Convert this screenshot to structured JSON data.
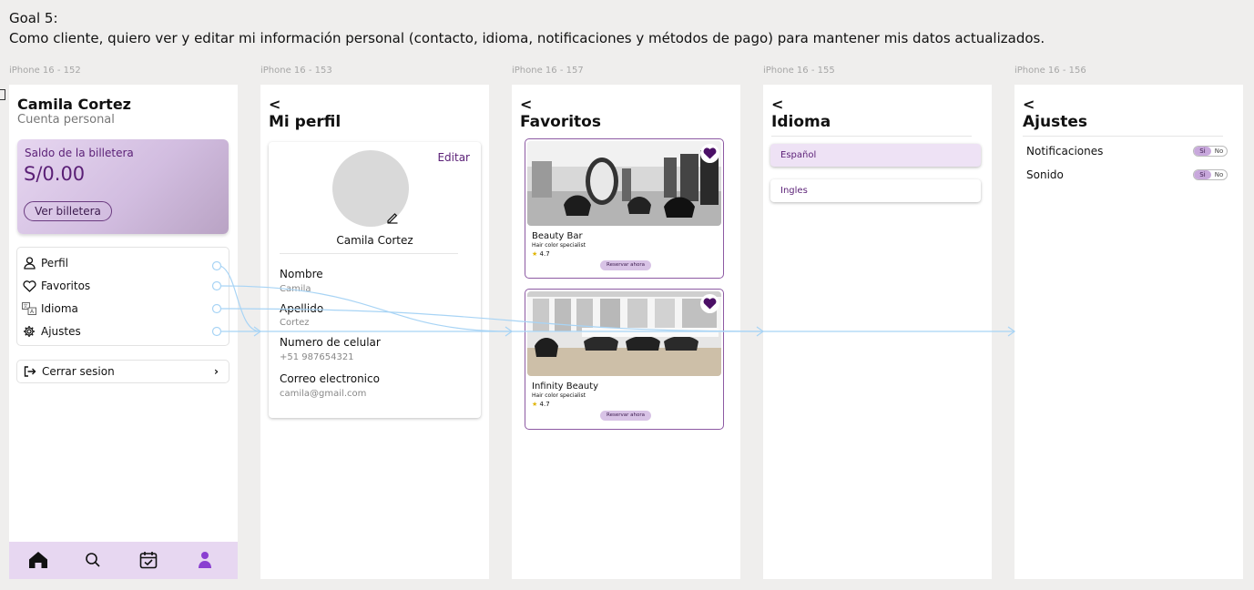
{
  "goal": {
    "title": "Goal 5:",
    "text": "Como cliente, quiero ver y editar mi información personal (contacto, idioma, notificaciones y métodos de pago) para mantener mis datos actualizados."
  },
  "frames": [
    {
      "label": "iPhone 16 - 152"
    },
    {
      "label": "iPhone 16 - 153"
    },
    {
      "label": "iPhone 16 - 157"
    },
    {
      "label": "iPhone 16 - 155"
    },
    {
      "label": "iPhone 16 - 156"
    }
  ],
  "account": {
    "name": "Camila Cortez",
    "subtitle": "Cuenta personal",
    "wallet_label": "Saldo de la billetera",
    "wallet_amount": "S/0.00",
    "wallet_button": "Ver billetera",
    "menu": [
      {
        "label": "Perfil",
        "icon": "person-icon"
      },
      {
        "label": "Favoritos",
        "icon": "heart-icon"
      },
      {
        "label": "Idioma",
        "icon": "translate-icon"
      },
      {
        "label": "Ajustes",
        "icon": "gear-icon"
      }
    ],
    "logout": "Cerrar sesion",
    "nav": [
      "home-icon",
      "search-icon",
      "calendar-check-icon",
      "profile-icon"
    ]
  },
  "profile": {
    "back": "<",
    "title": "Mi perfil",
    "edit": "Editar",
    "name": "Camila Cortez",
    "fields": [
      {
        "label": "Nombre",
        "value": "Camila"
      },
      {
        "label": "Apellido",
        "value": "Cortez"
      },
      {
        "label": "Numero de celular",
        "value": "+51 987654321"
      },
      {
        "label": "Correo electronico",
        "value": "camila@gmail.com"
      }
    ]
  },
  "favorites": {
    "back": "<",
    "title": "Favoritos",
    "items": [
      {
        "name": "Beauty Bar",
        "specialty": "Hair color specialist",
        "rating": "4.7",
        "button": "Reservar ahora"
      },
      {
        "name": "Infinity Beauty",
        "specialty": "Hair color specialist",
        "rating": "4.7",
        "button": "Reservar ahora"
      }
    ]
  },
  "language": {
    "back": "<",
    "title": "Idioma",
    "options": [
      {
        "label": "Español",
        "selected": true
      },
      {
        "label": "Ingles",
        "selected": false
      }
    ]
  },
  "settings": {
    "back": "<",
    "title": "Ajustes",
    "rows": [
      {
        "label": "Notificaciones",
        "on": "Si",
        "off": "No"
      },
      {
        "label": "Sonido",
        "on": "Si",
        "off": "No"
      }
    ]
  },
  "colors": {
    "accent": "#5a1f76",
    "light_purple": "#e7d7f1",
    "flow_line": "#a8d4f5"
  }
}
